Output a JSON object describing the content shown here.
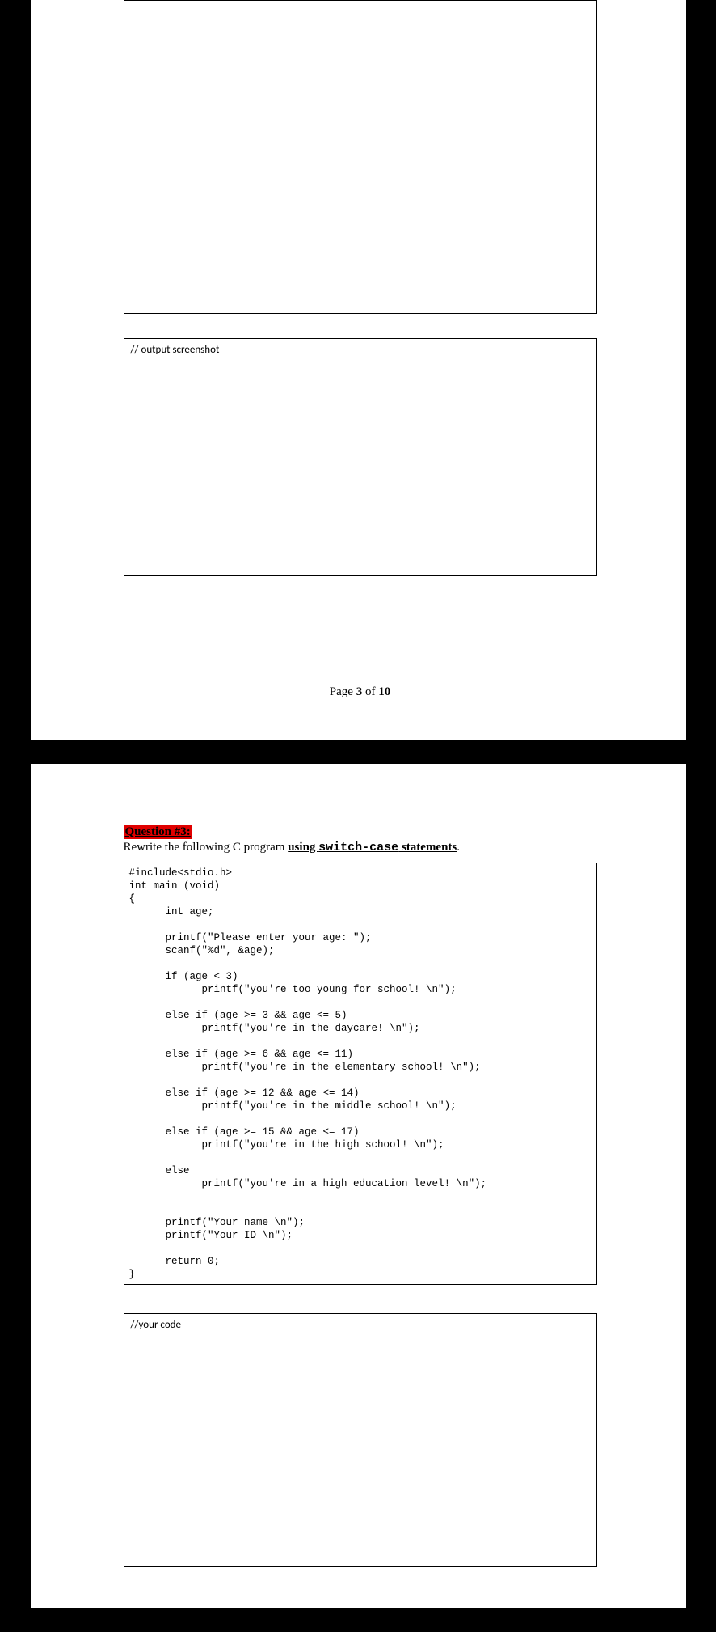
{
  "page1": {
    "output_label": "// output screenshot",
    "footer_prefix": "Page ",
    "footer_current": "3",
    "footer_mid": " of ",
    "footer_total": "10"
  },
  "page2": {
    "question_label": "Question #3:",
    "instructions_pre": "Rewrite the following C program ",
    "instructions_underline_pre": "using ",
    "instructions_code": "switch-case",
    "instructions_underline_post": " statements",
    "instructions_end": ".",
    "code": "#include<stdio.h>\nint main (void)\n{\n      int age;\n\n      printf(\"Please enter your age: \");\n      scanf(\"%d\", &age);\n\n      if (age < 3)\n            printf(\"you're too young for school! \\n\");\n\n      else if (age >= 3 && age <= 5)\n            printf(\"you're in the daycare! \\n\");\n\n      else if (age >= 6 && age <= 11)\n            printf(\"you're in the elementary school! \\n\");\n\n      else if (age >= 12 && age <= 14)\n            printf(\"you're in the middle school! \\n\");\n\n      else if (age >= 15 && age <= 17)\n            printf(\"you're in the high school! \\n\");\n\n      else\n            printf(\"you're in a high education level! \\n\");\n\n\n      printf(\"Your name \\n\");\n      printf(\"Your ID \\n\");\n\n      return 0;\n}",
    "yourcode_label": "//your code"
  }
}
